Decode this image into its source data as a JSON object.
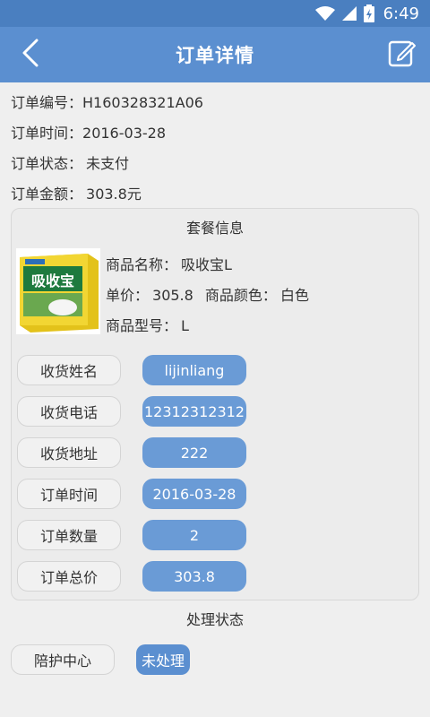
{
  "status_bar": {
    "time": "6:49",
    "wifi_icon": "wifi-icon",
    "signal_icon": "signal-icon",
    "battery_icon": "battery-charging-icon"
  },
  "app_bar": {
    "title": "订单详情",
    "back_icon": "chevron-left-icon",
    "edit_icon": "edit-icon"
  },
  "order": {
    "number_label": "订单编号：",
    "number": "H160328321A06",
    "time_label": "订单时间：",
    "time": "2016-03-28",
    "status_label": "订单状态：",
    "status": "未支付",
    "amount_label": "订单金额：",
    "amount": "303.8元"
  },
  "package": {
    "title": "套餐信息",
    "product_image_text": "吸收宝",
    "name_label": "商品名称：",
    "name": "吸收宝L",
    "price_label": "单价：",
    "price": "305.8",
    "color_label": "商品颜色：",
    "color": "白色",
    "model_label": "商品型号：",
    "model": "L",
    "fields": [
      {
        "label": "收货姓名",
        "value": "lijinliang"
      },
      {
        "label": "收货电话",
        "value": "12312312312"
      },
      {
        "label": "收货地址",
        "value": "222"
      },
      {
        "label": "订单时间",
        "value": "2016-03-28"
      },
      {
        "label": "订单数量",
        "value": "2"
      },
      {
        "label": "订单总价",
        "value": "303.8"
      }
    ]
  },
  "processing": {
    "title": "处理状态",
    "center": "陪护中心",
    "status": "未处理"
  },
  "colors": {
    "app_bar": "#5b8fd0",
    "status_bar": "#4a7fc0",
    "value_pill": "#6a9bd6",
    "background": "#efefef"
  }
}
